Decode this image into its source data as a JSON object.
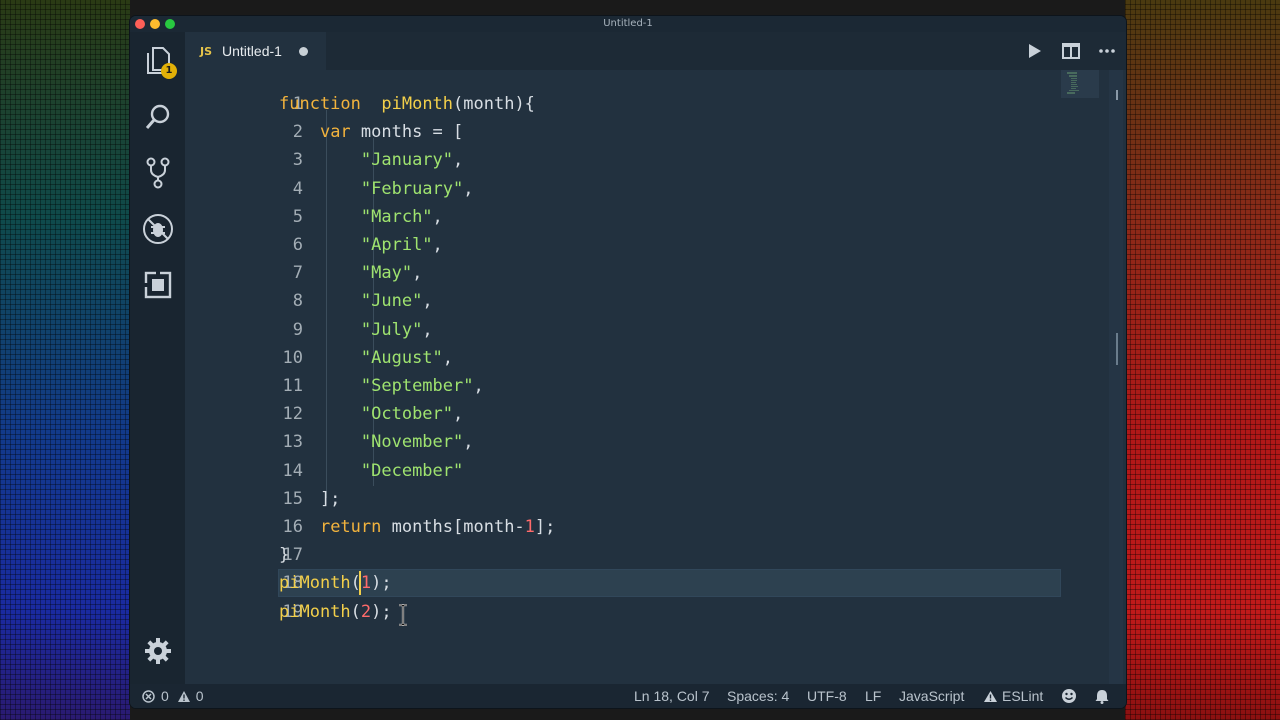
{
  "window": {
    "title": "Untitled-1"
  },
  "activity_bar": {
    "explorer_badge": "1"
  },
  "tab": {
    "language_badge": "JS",
    "title": "Untitled-1"
  },
  "editor": {
    "lines": [
      {
        "n": "1",
        "tokens": [
          [
            "kw",
            "function"
          ],
          [
            "",
            "  "
          ],
          [
            "fn",
            "piMonth"
          ],
          [
            "",
            "(month){"
          ]
        ]
      },
      {
        "n": "2",
        "tokens": [
          [
            "",
            "    "
          ],
          [
            "kw",
            "var"
          ],
          [
            "",
            " months = ["
          ]
        ]
      },
      {
        "n": "3",
        "tokens": [
          [
            "",
            "        "
          ],
          [
            "str",
            "\"January\""
          ],
          [
            "",
            ","
          ]
        ]
      },
      {
        "n": "4",
        "tokens": [
          [
            "",
            "        "
          ],
          [
            "str",
            "\"February\""
          ],
          [
            "",
            ","
          ]
        ]
      },
      {
        "n": "5",
        "tokens": [
          [
            "",
            "        "
          ],
          [
            "str",
            "\"March\""
          ],
          [
            "",
            ","
          ]
        ]
      },
      {
        "n": "6",
        "tokens": [
          [
            "",
            "        "
          ],
          [
            "str",
            "\"April\""
          ],
          [
            "",
            ","
          ]
        ]
      },
      {
        "n": "7",
        "tokens": [
          [
            "",
            "        "
          ],
          [
            "str",
            "\"May\""
          ],
          [
            "",
            ","
          ]
        ]
      },
      {
        "n": "8",
        "tokens": [
          [
            "",
            "        "
          ],
          [
            "str",
            "\"June\""
          ],
          [
            "",
            ","
          ]
        ]
      },
      {
        "n": "9",
        "tokens": [
          [
            "",
            "        "
          ],
          [
            "str",
            "\"July\""
          ],
          [
            "",
            ","
          ]
        ]
      },
      {
        "n": "10",
        "tokens": [
          [
            "",
            "        "
          ],
          [
            "str",
            "\"August\""
          ],
          [
            "",
            ","
          ]
        ]
      },
      {
        "n": "11",
        "tokens": [
          [
            "",
            "        "
          ],
          [
            "str",
            "\"September\""
          ],
          [
            "",
            ","
          ]
        ]
      },
      {
        "n": "12",
        "tokens": [
          [
            "",
            "        "
          ],
          [
            "str",
            "\"October\""
          ],
          [
            "",
            ","
          ]
        ]
      },
      {
        "n": "13",
        "tokens": [
          [
            "",
            "        "
          ],
          [
            "str",
            "\"November\""
          ],
          [
            "",
            ","
          ]
        ]
      },
      {
        "n": "14",
        "tokens": [
          [
            "",
            "        "
          ],
          [
            "str",
            "\"December\""
          ]
        ]
      },
      {
        "n": "15",
        "tokens": [
          [
            "",
            "    ];"
          ]
        ]
      },
      {
        "n": "16",
        "tokens": [
          [
            "",
            "    "
          ],
          [
            "kw",
            "return"
          ],
          [
            "",
            " months[month-"
          ],
          [
            "num",
            "1"
          ],
          [
            "",
            "];"
          ]
        ]
      },
      {
        "n": "17",
        "tokens": [
          [
            "",
            "}"
          ]
        ]
      },
      {
        "n": "18",
        "tokens": [
          [
            "fn",
            "piMonth"
          ],
          [
            "",
            "("
          ],
          [
            "num",
            "1"
          ],
          [
            "",
            ");"
          ]
        ]
      },
      {
        "n": "19",
        "tokens": [
          [
            "fn",
            "piMonth"
          ],
          [
            "",
            "("
          ],
          [
            "num",
            "2"
          ],
          [
            "",
            ");"
          ]
        ]
      }
    ],
    "current_line": 18
  },
  "statusbar": {
    "errors": "0",
    "warnings": "0",
    "position": "Ln 18, Col 7",
    "indent": "Spaces: 4",
    "encoding": "UTF-8",
    "eol": "LF",
    "language": "JavaScript",
    "linter": "ESLint"
  },
  "icons": {
    "activity": [
      "files-icon",
      "search-icon",
      "source-control-icon",
      "debug-icon",
      "extensions-icon",
      "settings-gear-icon"
    ],
    "toolbar": [
      "run-icon",
      "split-editor-icon",
      "more-actions-icon"
    ],
    "status": [
      "error-icon",
      "warning-icon",
      "warning-triangle-icon",
      "smiley-feedback-icon",
      "bell-notification-icon"
    ]
  },
  "colors": {
    "editor_bg": "#22313f",
    "keyword": "#f2b33d",
    "function": "#f2cf4a",
    "string": "#9fe36f",
    "number": "#ff6b6b",
    "dirty_badge": "#e2b007"
  }
}
